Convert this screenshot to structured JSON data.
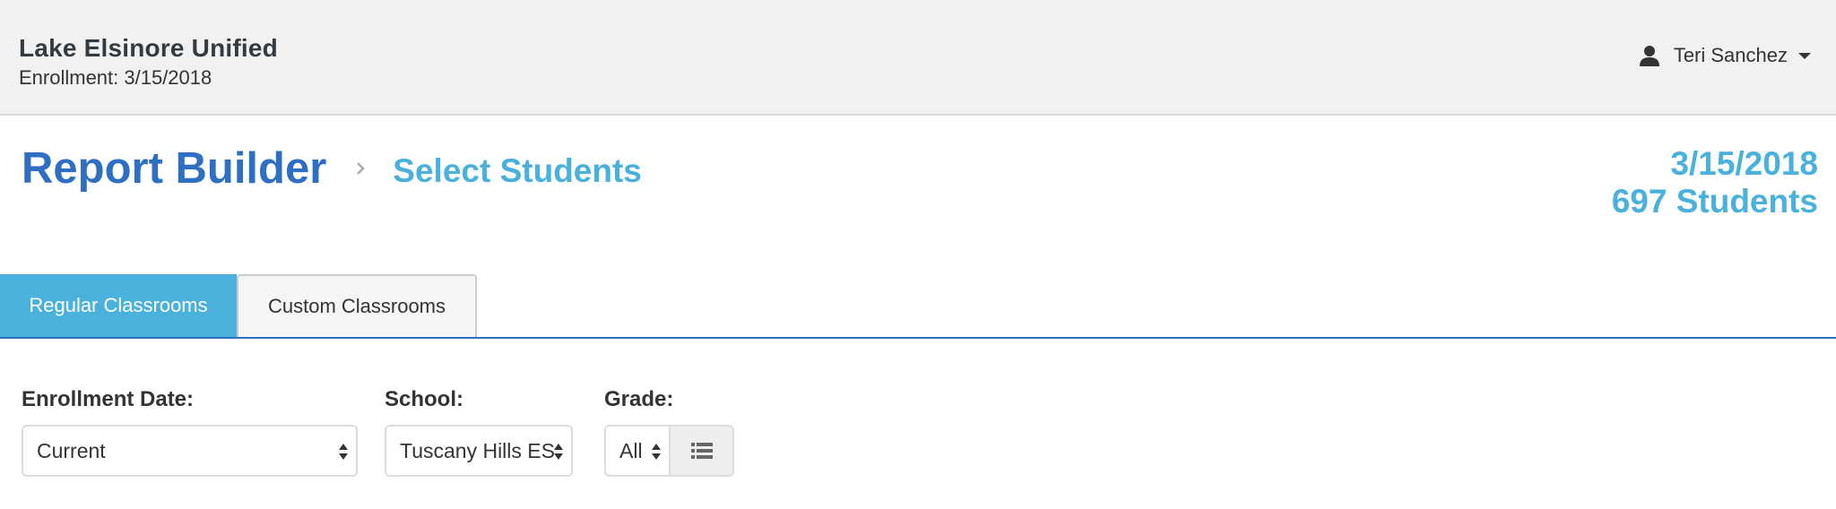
{
  "header": {
    "org_name": "Lake Elsinore Unified",
    "enrollment_text": "Enrollment: 3/15/2018",
    "user_name": "Teri Sanchez",
    "user_icon": "user-icon",
    "menu_icon": "caret-down-icon"
  },
  "title": {
    "main": "Report Builder",
    "separator_icon": "chevron-right-icon",
    "step": "Select Students"
  },
  "summary": {
    "date": "3/15/2018",
    "students": "697 Students"
  },
  "tabs": [
    {
      "label": "Regular Classrooms",
      "active": true
    },
    {
      "label": "Custom Classrooms",
      "active": false
    }
  ],
  "filters": {
    "enrollment_date": {
      "label": "Enrollment Date:",
      "value": "Current"
    },
    "school": {
      "label": "School:",
      "value": "Tuscany Hills ES"
    },
    "grade": {
      "label": "Grade:",
      "value": "All",
      "list_icon": "list-icon"
    }
  },
  "colors": {
    "primary_blue": "#2e6fc4",
    "accent_blue": "#4ab1dd",
    "header_bg": "#f1f1f2"
  }
}
